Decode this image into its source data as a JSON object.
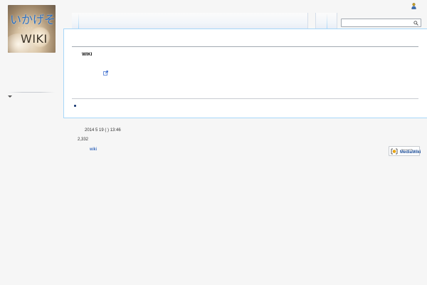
{
  "logo": {
    "title": "いかげそ",
    "subtitle_dots": "• • • • •",
    "wiki": "WIKI"
  },
  "content": {
    "heading": "WIKI"
  },
  "footer": {
    "last_modified": "2014 5  19  (  )  13:46",
    "views": "2,332",
    "link": "wiki",
    "badge_small": "Powered By",
    "badge_big": "MediaWiki"
  },
  "colors": {
    "content_border": "#a7d7f9",
    "link": "#0645ad",
    "logo_text": "#2b6fc0"
  },
  "icons": {
    "user": "user-icon",
    "search": "search-icon",
    "external_link": "external-link-icon",
    "sidebar_toggle": "chevron-down-icon"
  }
}
